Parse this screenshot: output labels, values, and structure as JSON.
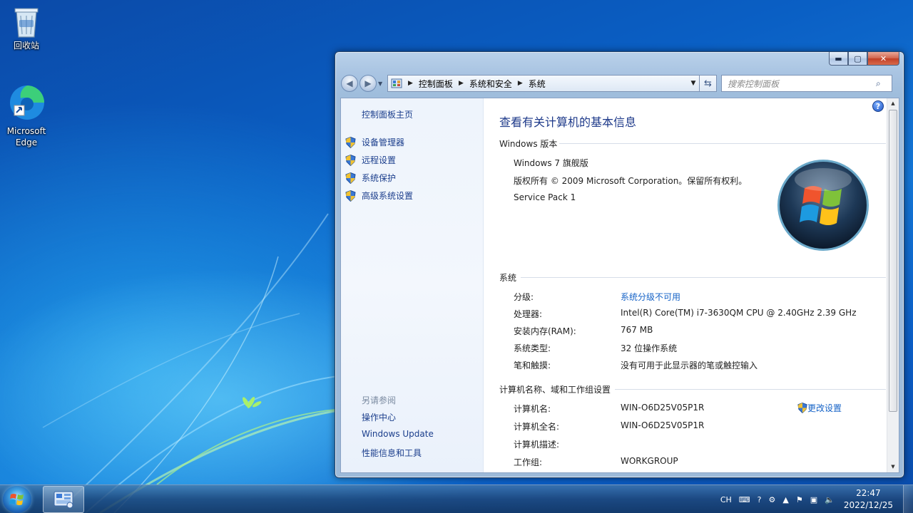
{
  "desktop": {
    "icons": [
      {
        "label": "回收站",
        "icon": "recycle-bin-icon"
      },
      {
        "label": "Microsoft Edge",
        "icon": "edge-icon"
      }
    ]
  },
  "window": {
    "address": {
      "crumbs": [
        "控制面板",
        "系统和安全",
        "系统"
      ]
    },
    "search": {
      "placeholder": "搜索控制面板"
    },
    "left_pane": {
      "home": "控制面板主页",
      "tasks": [
        "设备管理器",
        "远程设置",
        "系统保护",
        "高级系统设置"
      ],
      "see_also_title": "另请参阅",
      "see_also": [
        "操作中心",
        "Windows Update",
        "性能信息和工具"
      ]
    },
    "main": {
      "title": "查看有关计算机的基本信息",
      "edition": {
        "heading": "Windows 版本",
        "name": "Windows 7 旗舰版",
        "copyright": "版权所有 © 2009 Microsoft Corporation。保留所有权利。",
        "service_pack": "Service Pack 1"
      },
      "system": {
        "heading": "系统",
        "rows": [
          {
            "label": "分级:",
            "value": "系统分级不可用",
            "link": true
          },
          {
            "label": "处理器:",
            "value": "Intel(R) Core(TM) i7-3630QM CPU @ 2.40GHz   2.39 GHz"
          },
          {
            "label": "安装内存(RAM):",
            "value": "767 MB"
          },
          {
            "label": "系统类型:",
            "value": "32 位操作系统"
          },
          {
            "label": "笔和触摸:",
            "value": "没有可用于此显示器的笔或触控输入"
          }
        ]
      },
      "computer": {
        "heading": "计算机名称、域和工作组设置",
        "change_label": "更改设置",
        "rows": [
          {
            "label": "计算机名:",
            "value": "WIN-O6D25V05P1R"
          },
          {
            "label": "计算机全名:",
            "value": "WIN-O6D25V05P1R"
          },
          {
            "label": "计算机描述:",
            "value": ""
          },
          {
            "label": "工作组:",
            "value": "WORKGROUP"
          }
        ]
      }
    }
  },
  "taskbar": {
    "tray_lang": "CH",
    "time": "22:47",
    "date": "2022/12/25"
  }
}
